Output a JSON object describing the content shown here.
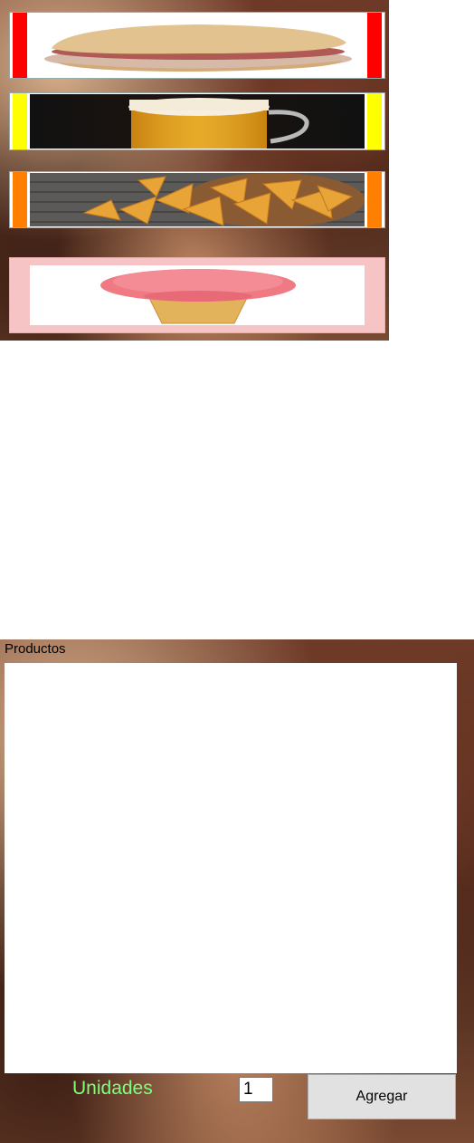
{
  "products": [
    {
      "name": "sandwich",
      "color": "#ff0000"
    },
    {
      "name": "beer",
      "color": "#ffff00"
    },
    {
      "name": "chips",
      "color": "#ff8000"
    },
    {
      "name": "ice-cream",
      "color": "#ffc0c0"
    }
  ],
  "list": {
    "label": "Productos",
    "items": []
  },
  "order": {
    "units_label": "Unidades",
    "units_value": "1",
    "add_label": "Agregar"
  },
  "colors": {
    "units_label": "#7dff7d",
    "button_bg": "#e1e1e1"
  }
}
